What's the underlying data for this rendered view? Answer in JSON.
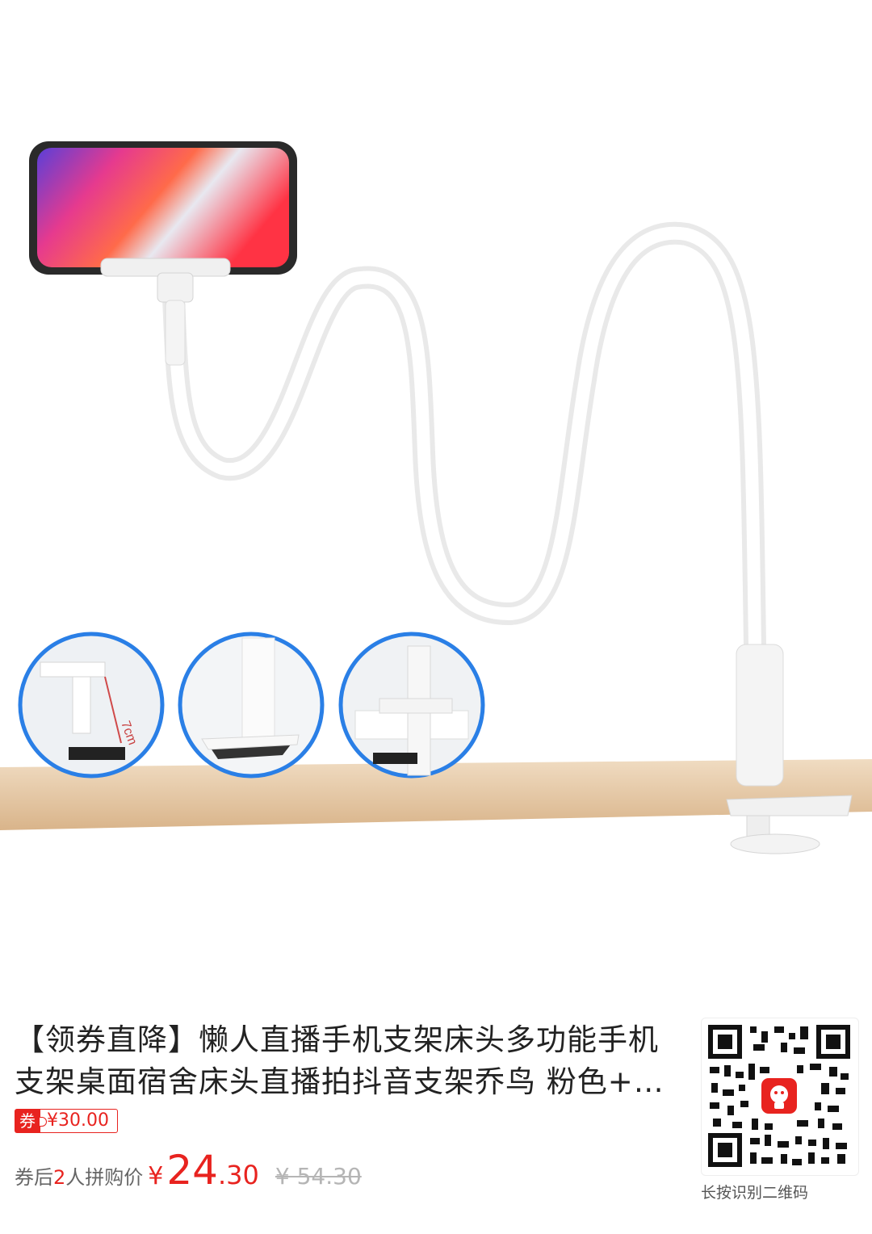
{
  "product": {
    "title": "【领券直降】懒人直播手机支架床头多功能手机支架桌面宿舍床头直播拍抖音支架乔鸟 粉色+…",
    "image_annotation": "7cm"
  },
  "coupon": {
    "tag": "券",
    "value": "¥30.00"
  },
  "price": {
    "label_prefix": "券后",
    "group_count": "2",
    "label_suffix": "人拼购价",
    "symbol": "¥",
    "integer": "24",
    "decimal": ".30",
    "original": "¥ 54.30"
  },
  "qr": {
    "caption": "长按识别二维码"
  },
  "colors": {
    "accent": "#e8231f",
    "muted": "#b5b5b5"
  }
}
